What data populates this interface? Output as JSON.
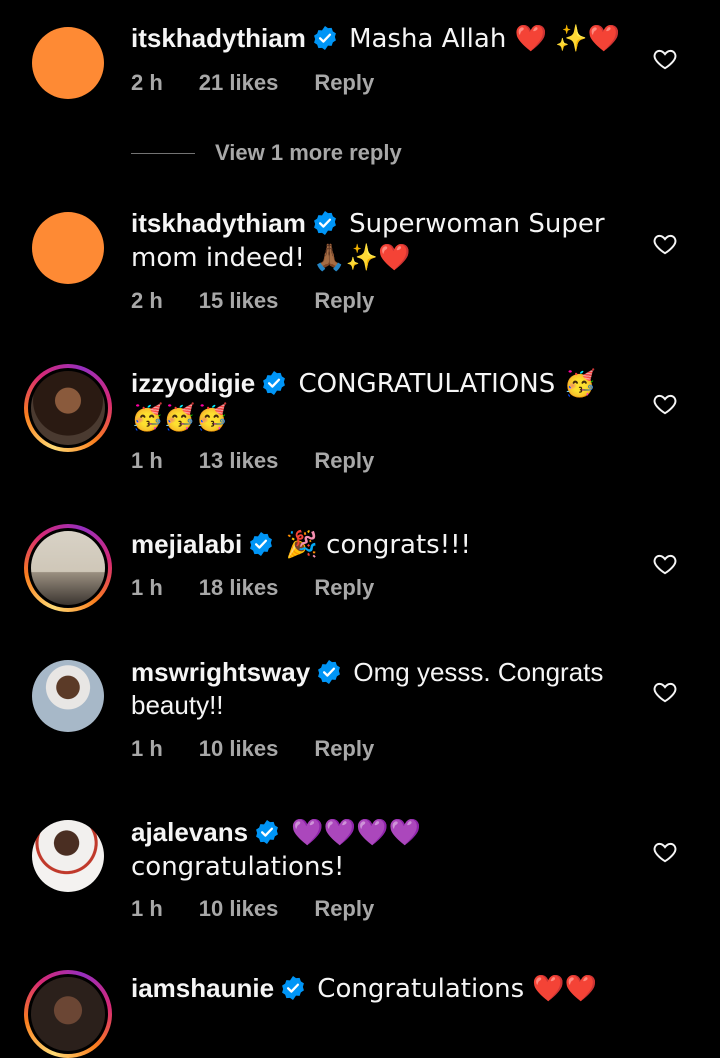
{
  "comments": [
    {
      "username": "itskhadythiam",
      "text": "Masha Allah ❤️ ✨❤️",
      "time": "2 h",
      "likes": "21 likes",
      "reply": "Reply",
      "avatar": "orange-placeholder"
    },
    {
      "username": "itskhadythiam",
      "text": "Superwoman Super mom indeed! 🙏🏾✨❤️",
      "time": "2 h",
      "likes": "15 likes",
      "reply": "Reply",
      "avatar": "orange-placeholder"
    },
    {
      "username": "izzyodigie",
      "text": "CONGRATULATIONS 🥳 🥳🥳🥳",
      "time": "1 h",
      "likes": "13 likes",
      "reply": "Reply",
      "avatar": "story-ring"
    },
    {
      "username": "mejialabi",
      "text": "🎉 congrats!!!",
      "time": "1 h",
      "likes": "18 likes",
      "reply": "Reply",
      "avatar": "story-ring"
    },
    {
      "username": "mswrightsway",
      "text": "Omg yesss. Congrats beauty!!",
      "time": "1 h",
      "likes": "10 likes",
      "reply": "Reply",
      "avatar": "photo"
    },
    {
      "username": "ajalevans",
      "text": "💜💜💜💜 congratulations!",
      "time": "1 h",
      "likes": "10 likes",
      "reply": "Reply",
      "avatar": "photo"
    },
    {
      "username": "iamshaunie",
      "text": "Congratulations ❤️❤️",
      "avatar": "story-ring"
    }
  ],
  "view_more": {
    "label": "View 1 more reply"
  },
  "colors": {
    "background": "#000000",
    "text": "#f5f5f5",
    "muted": "#a8a8a8",
    "verified": "#0095f6",
    "placeholder_avatar": "#fe8a34"
  },
  "icons": {
    "verified": "verified-badge-icon",
    "like": "heart-outline-icon"
  }
}
